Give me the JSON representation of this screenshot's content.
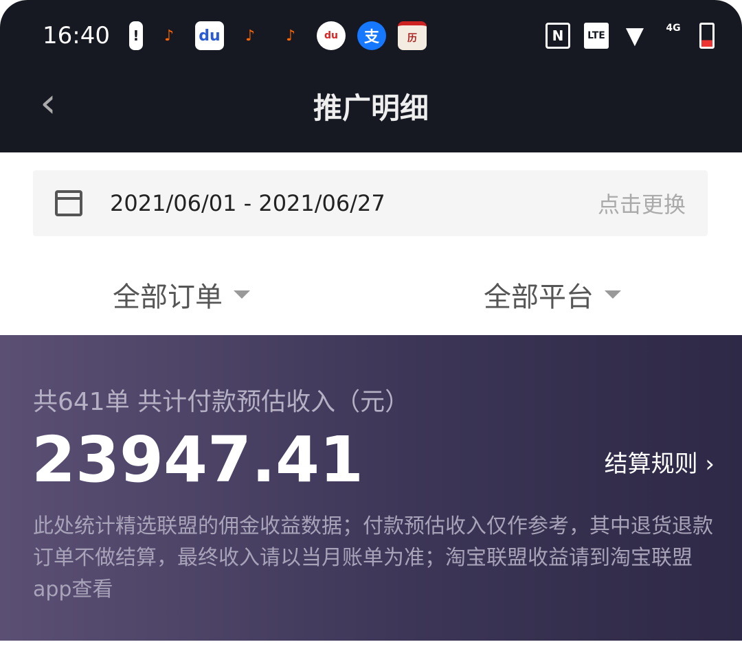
{
  "status_bar": {
    "time": "16:40",
    "notification_icons": [
      "battery-alert-icon",
      "douyin-icon",
      "baidu-icon",
      "douyin-icon",
      "douyin-icon",
      "baidu-map-icon",
      "alipay-icon",
      "calendar-app-icon"
    ],
    "right_icons": [
      "nfc-icon",
      "volte-icon",
      "wifi-icon",
      "signal-4g-icon",
      "battery-icon"
    ],
    "volte": "LTE",
    "network": "4G"
  },
  "header": {
    "title": "推广明细"
  },
  "date_range": {
    "value": "2021/06/01 - 2021/06/27",
    "change_label": "点击更换"
  },
  "filters": {
    "orders": "全部订单",
    "platforms": "全部平台"
  },
  "summary": {
    "heading": "共641单 共计付款预估收入（元）",
    "amount": "23947.41",
    "rules_label": "结算规则",
    "note": "此处统计精选联盟的佣金收益数据；付款预估收入仅作参考，其中退货退款订单不做结算，最终收入请以当月账单为准；淘宝联盟收益请到淘宝联盟app查看"
  },
  "colors": {
    "header_bg": "#171922",
    "card_gradient_start": "#5b5074",
    "card_gradient_end": "#2e2946"
  }
}
